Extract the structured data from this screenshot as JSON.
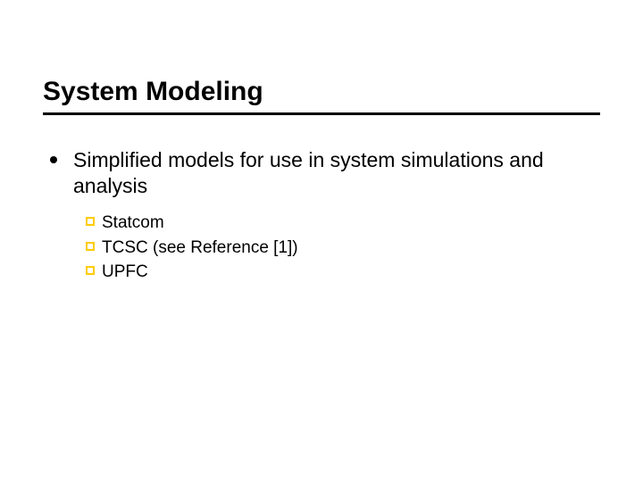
{
  "slide": {
    "title": "System Modeling",
    "bullet1": "Simplified models for use in system simulations and analysis",
    "subitems": {
      "a": "Statcom",
      "b": "TCSC (see Reference [1])",
      "c": "UPFC"
    }
  }
}
